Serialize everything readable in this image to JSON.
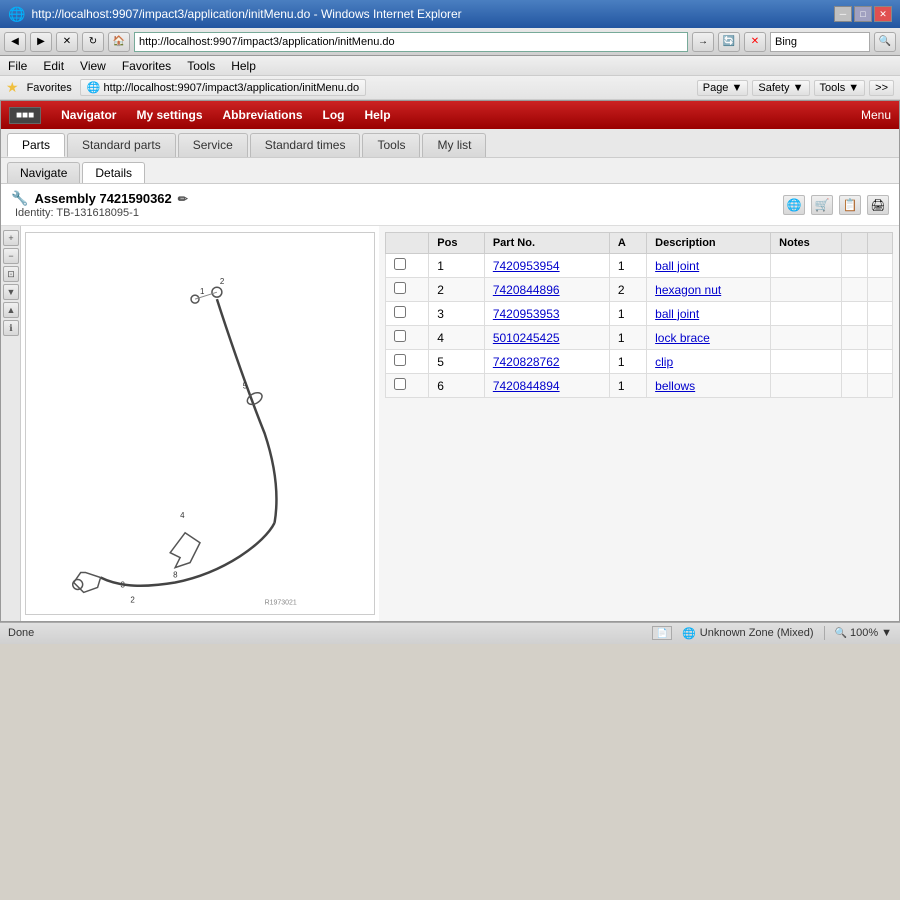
{
  "browser": {
    "title": "http://localhost:9907/impact3/application/initMenu.do - Windows Internet Explorer",
    "address": "http://localhost:9907/impact3/application/initMenu.do",
    "search_placeholder": "Bing",
    "search_value": "Bing",
    "menubar": [
      "File",
      "Edit",
      "View",
      "Favorites",
      "Tools",
      "Help"
    ],
    "favorites_label": "Favorites",
    "favorites_link": "http://localhost:9907/impact3/application/initMenu.do",
    "titlebar_controls": [
      "─",
      "□",
      "✕"
    ],
    "toolbar_right_buttons": [
      "Page ▼",
      "Safety ▼",
      "Tools ▼",
      ">>"
    ]
  },
  "app": {
    "navbar": {
      "logo": "■■■",
      "items": [
        "Navigator",
        "My settings",
        "Abbreviations",
        "Log",
        "Help"
      ],
      "menu_label": "Menu"
    },
    "tabs": [
      "Parts",
      "Standard parts",
      "Service",
      "Standard times",
      "Tools",
      "My list"
    ],
    "active_tab": "Parts",
    "subtabs": [
      "Navigate",
      "Details"
    ],
    "active_subtab": "Details",
    "assembly": {
      "title": "Assembly 7421590362",
      "identity": "Identity: TB-131618095-1"
    },
    "toolbar_icons": [
      "🌐",
      "🛒",
      "📋",
      "🖨"
    ]
  },
  "parts_table": {
    "columns": [
      "",
      "Pos",
      "Part No.",
      "A",
      "Description",
      "Notes",
      "",
      ""
    ],
    "rows": [
      {
        "pos": "1",
        "part_no": "7420953954",
        "a": "1",
        "description": "ball joint",
        "notes": ""
      },
      {
        "pos": "2",
        "part_no": "7420844896",
        "a": "2",
        "description": "hexagon nut",
        "notes": ""
      },
      {
        "pos": "3",
        "part_no": "7420953953",
        "a": "1",
        "description": "ball joint",
        "notes": ""
      },
      {
        "pos": "4",
        "part_no": "5010245425",
        "a": "1",
        "description": "lock brace",
        "notes": ""
      },
      {
        "pos": "5",
        "part_no": "7420828762",
        "a": "1",
        "description": "clip",
        "notes": ""
      },
      {
        "pos": "6",
        "part_no": "7420844894",
        "a": "1",
        "description": "bellows",
        "notes": ""
      }
    ]
  },
  "left_tools": [
    "🔍",
    "🔍",
    "📄",
    "▶",
    "◀",
    "🔧"
  ],
  "status": {
    "left": "Done",
    "zone": "Unknown Zone (Mixed)",
    "zoom": "100%"
  },
  "diagram_ref": "R1973021"
}
